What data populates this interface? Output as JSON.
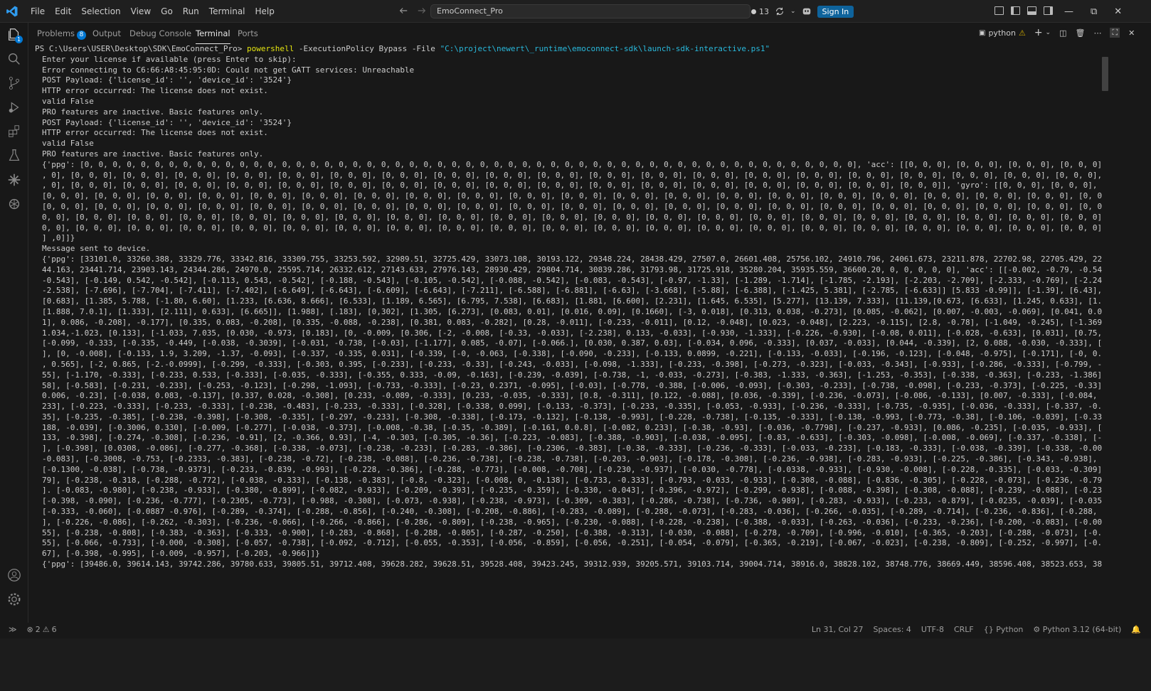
{
  "titlebar": {
    "menu": [
      "File",
      "Edit",
      "Selection",
      "View",
      "Go",
      "Run",
      "Terminal",
      "Help"
    ],
    "search_text": "EmoConnect_Pro",
    "changes_count": "13",
    "signin_label": "Sign In"
  },
  "activity": {
    "explorer_badge": "1"
  },
  "panel": {
    "tabs": [
      "Problems",
      "Output",
      "Debug Console",
      "Terminal",
      "Ports"
    ],
    "problems_count": "8",
    "shell_label": "python"
  },
  "terminal": {
    "lines": [
      {
        "kind": "prompt",
        "prompt": "PS C:\\Users\\USER\\Desktop\\SDK\\EmoConnect_Pro> ",
        "kw": "powershell",
        "args": " -ExecutionPolicy Bypass -File ",
        "path": "\"C:\\project\\newert\\_runtime\\emoconnect-sdk\\launch-sdk-interactive.ps1\""
      },
      {
        "kind": "out",
        "text": "Enter your license if available (press Enter to skip):"
      },
      {
        "kind": "out",
        "text": "Error connecting to C6:66:A8:45:95:0D: Could not get GATT services: Unreachable"
      },
      {
        "kind": "out",
        "text": "POST Payload: {'license_id': '', 'device_id': '3524'}"
      },
      {
        "kind": "out",
        "text": "HTTP error occurred: The license does not exist."
      },
      {
        "kind": "out",
        "text": "valid False"
      },
      {
        "kind": "out",
        "text": "PRO features are inactive. Basic features only."
      },
      {
        "kind": "out",
        "text": "POST Payload: {'license_id': '', 'device_id': '3524'}"
      },
      {
        "kind": "out",
        "text": "HTTP error occurred: The license does not exist."
      },
      {
        "kind": "out",
        "text": "valid False"
      },
      {
        "kind": "out",
        "text": "PRO features are inactive. Basic features only."
      },
      {
        "kind": "out",
        "text": "{'ppg': [0, 0, 0, 0, 0, 0, 0, 0, 0, 0, 0, 0, 0, 0, 0, 0, 0, 0, 0, 0, 0, 0, 0, 0, 0, 0, 0, 0, 0, 0, 0, 0, 0, 0, 0, 0, 0, 0, 0, 0, 0, 0, 0, 0, 0, 0, 0, 0, 0, 0, 0, 0, 0, 0, 0], 'acc': [[0, 0, 0], [0, 0, 0], [0, 0, 0], [0, 0, 0], [0, 0, 0], [0, 0, 0], [0, 0"
      },
      {
        "kind": "out",
        "text": ", 0], [0, 0, 0], [0, 0, 0], [0, 0, 0], [0, 0, 0], [0, 0, 0], [0, 0, 0], [0, 0, 0], [0, 0, 0], [0, 0, 0], [0, 0, 0], [0, 0, 0], [0, 0, 0], [0, 0, 0], [0, 0, 0], [0, 0, 0], [0, 0, 0], [0, 0, 0], [0, 0, 0], [0, 0, 0], [0, 0, 0], [0, 0, 0], [0"
      },
      {
        "kind": "out",
        "text": ", 0], [0, 0, 0], [0, 0, 0], [0, 0, 0], [0, 0, 0], [0, 0, 0], [0, 0, 0], [0, 0, 0], [0, 0, 0], [0, 0, 0], [0, 0, 0], [0, 0, 0], [0, 0, 0], [0, 0, 0], [0, 0, 0], [0, 0, 0], [0, 0, 0], [0, 0, 0]], 'gyro': [[0, 0, 0], [0, 0, 0], [0, 0, 0],[0, 0,"
      },
      {
        "kind": "out",
        "text": "[0, 0, 0], [0, 0, 0], [0, 0, 0], [0, 0, 0], [0, 0, 0], [0, 0, 0], [0, 0, 0], [0, 0, 0], [0, 0, 0], [0, 0, 0], [0, 0, 0], [0, 0, 0], [0, 0, 0], [0, 0, 0], [0, 0, 0], [0, 0, 0], [0, 0, 0], [0, 0, 0], [0, 0, 0], [0, 0, 0], [0, 0,"
      },
      {
        "kind": "out",
        "text": "[0, 0, 0], [0, 0, 0], [0, 0, 0], [0, 0, 0], [0, 0, 0], [0, 0, 0], [0, 0, 0], [0, 0, 0], [0, 0, 0], [0, 0, 0], [0, 0, 0], [0, 0, 0], [0, 0, 0], [0, 0, 0], [0, 0, 0], [0, 0, 0], [0, 0, 0], [0, 0, 0], [0, 0, 0], [0, 0, 0], [0, 0,"
      },
      {
        "kind": "out",
        "text": "0, 0], [0, 0, 0], [0, 0, 0], [0, 0, 0], [0, 0, 0], [0, 0, 0], [0, 0, 0], [0, 0, 0], [0, 0, 0], [0, 0, 0], [0, 0, 0], [0, 0, 0], [0, 0, 0], [0, 0, 0], [0, 0, 0], [0, 0, 0], [0, 0, 0], [0, 0, 0], [0, 0, 0], [0, 0, 0], [0, 0, 0], ["
      },
      {
        "kind": "out",
        "text": "0, 0], [0, 0, 0], [0, 0, 0], [0, 0, 0], [0, 0, 0], [0, 0, 0], [0, 0, 0], [0, 0, 0], [0, 0, 0], [0, 0, 0], [0, 0, 0], [0, 0, 0], [0, 0, 0], [0, 0, 0], [0, 0, 0], [0, 0, 0], [0, 0, 0], [0, 0, 0], [0, 0, 0], [0, 0, 0], [0, 0, 0],[0,0,"
      },
      {
        "kind": "out",
        "text": "] ,0]]}"
      },
      {
        "kind": "out",
        "text": "Message sent to device."
      },
      {
        "kind": "out",
        "text": "{'ppg': [33101.0, 33260.388, 33329.776, 33342.816, 33309.755, 33253.592, 32989.51, 32725.429, 33073.108, 30193.122, 29348.224, 28438.429, 27507.0, 26601.408, 25756.102, 24910.796, 24061.673, 23211.878, 22702.98, 22705.429, 22707.878, 22920.49, 231"
      },
      {
        "kind": "out",
        "text": "44.163, 23441.714, 23903.143, 24344.286, 24970.0, 25595.714, 26332.612, 27143.633, 27976.143, 28930.429, 29804.714, 30839.286, 31793.98, 31725.918, 35280.204, 35935.559, 36600.20, 0, 0, 0, 0, 0], 'acc': [[-0.002, -0.79, -0.547], [-0.001, 0.108,"
      },
      {
        "kind": "out",
        "text": "-0.543], [-0.149, 0.542, -0.542], [-0.113, 0.543, -0.542], [-0.188, -0.543], [-0.105, -0.542], [-0.088, -0.542], [-0.083, -0.543], [-0.97, -1.33], [-1.289, -1.714], [-1.785, -2.193], [-2.203, -2.709], [-2.333, -0.769], [-2.248, -3.593], [-2.706,"
      },
      {
        "kind": "out",
        "text": "-2.538], [-7.696], [-7.704], [-7.411], [-7.402], [-6.649], [-6.643], [-6.609], [-6.643], [-7.211], [-6.588], [-6.881], [-6.63], [-3.668], [-5.88], [-6.388], [-1.425, 5.381], [-2.785, [-6.633]] [5.833 -0.99]], [-1.39], [6.43], [6.27], [-2385, 6.388],"
      },
      {
        "kind": "out",
        "text": "[0.683], [1.385, 5.788, [-1.80, 6.60], [1.233, [6.636, 8.666], [6.533], [1.189, 6.565], [6.795, 7.538], [6.683], [1.881, [6.600], [2.231], [1.645, 6.535], [5.277], [13.139, 7.333], [11.139,[0.673, [6.633], [1.245, 0.633], [1.389], [1.653, 8.39], [6.313"
      },
      {
        "kind": "out",
        "text": "[1.888, 7.0.1], [1.333], [2.111], 0.633], [6.665]], [1.988], [.183], [0,302], [1.305, [6.273], [0.083, 0.01], [0.016, 0.09], [0.1660], [-3, 0.018], [0.313, 0.038, -0.273], [0.085, -0.062], [0.007, -0.003, -0.069], [0.041, 0.016, -0.095], [0.0"
      },
      {
        "kind": "out",
        "text": "1], 0.086, -0.208], -0.177], [0.335, 0.083, -0.208], [0.335, -0.088, -0.238], [0.381, 0.083, -0.282], [0.28, -0.011], [-0.233, -0.011], [0.12, -0.048], [0.023, -0.048], [2.223, -0.115], [2.8, -0.78], [-1.049, -0.245], [-1.369, -0.098, -0.088, [-1"
      },
      {
        "kind": "out",
        "text": "1.034,-1.023, [0.133], [-1.033, 7.035, [0.030, -0.973, [0.183], [0, -0.009, [0.306, [-2, -0.008, [-0.33, -0.033], [-2.238], 0.133, -0.033], [-0.930, -1.333], [-0.226, -0.930], [-0.08, 0.011], [-0.028, -0.633], [0.031], [0.75,-0.099], [-0.246 ["
      },
      {
        "kind": "out",
        "text": "[-0.099, -0.333, [-0.335, -0.449, [-0.038, -0.3039], [-0.031, -0.738, [-0.03], [-1.177], 0.085, -0.07], [-0.066.], [0.030, 0.387, 0.03], [-0.034, 0.096, -0.333], [0.037, -0.033], [0.044, -0.339], [2, 0.088, -0.030, -0.333], [0.028, 0.003, -0.73,"
      },
      {
        "kind": "out",
        "text": "], [0, -0.008], [-0.133, 1.9, 3.209, -1.37, -0.093], [-0.337, -0.335, 0.031], [-0.339, [-0, -0.063, [-0.338], [-0.090, -0.233], [-0.133, 0.0899, -0.221], [-0.133, -0.033], [-0.196, -0.123], [-0.048, -0.975], [-0.171], [-0, 0.080], [-0, -1"
      },
      {
        "kind": "out",
        "text": ", 0.565], [-2, 0.865, [-2.-0.0999], [-0.299, -0.333], [-0.303, 0.395, [-0.233], [-0.233, -0.33], [-0.243, -0.033], [-0.098, -1.333], [-0.233, -0.398], [-0.273, -0.323], [-0.033, -0.343], [-0.933], [-0.286, -0.333], [-0.799, -1.933], [-0.330, 0.3"
      },
      {
        "kind": "out",
        "text": "55], [-1.170, -0.333], [-0.233, 0.533, [-0.333], [-0.035, -0.333], [-0.355, 0.333, -0.09, -0.163], [-0.239, -0.039], [-0.738, -1, -0.033, -0.273], [-0.383, -1.333, -0.363], [-1.253, -0.353], [-0.338, -0.363], [-0.233, -1.386], [-0.239, -0.7"
      },
      {
        "kind": "out",
        "text": "58], [-0.583], [-0.231, -0.233], [-0.253, -0.123], [-0.298, -1.093], [-0.733, -0.333], [-0.23, 0.2371, -0.095], [-0.03], [-0.778, -0.388, [-0.006, -0.093], [-0.303, -0.233], [-0.738, -0.098], [-0.233, -0.373], [-0.225, -0.33], [-0.088,"
      },
      {
        "kind": "out",
        "text": "0.006, -0.23], [-0.038, 0.083, -0.137], [0.337, 0.028, -0.308], [0.233, -0.089, -0.333], [0.233, -0.035, -0.333], [0.8, -0.311], [0.122, -0.088], [0.036, -0.339], [-0.236, -0.073], [-0.086, -0.133], [0.007, -0.333], [-0.084, -0.18], [-0.080, -0."
      },
      {
        "kind": "out",
        "text": "233], [-0.223, -0.333], [-0.233, -0.333], [-0.238, -0.483], [-0.233, -0.333], [-0.328], [-0.338, 0.099], [-0.133, -0.373], [-0.233, -0.335], [-0.053, -0.933], [-0.236, -0.333], [-0.735, -0.935], [-0.036, -0.333], [-0.337, -0.339], [-0.330, -0.33"
      },
      {
        "kind": "out",
        "text": "35], [-0.235, -0.385], [-0.238, -0.398], [-0.308, -0.335], [-0.297, -0.233], [-0.308, -0.338], [-0.173, -0.132], [-0.138, -0.993], [-0.228, -0.738], [-0.135, -0.333], [-0.138, -0.993, [-0.773, -0.38], [-0.106, -0.039], [-0.338, -0.03], [-0"
      },
      {
        "kind": "out",
        "text": "188, -0.039], [-0.3006, 0.330], [-0.009, [-0.277], [-0.038, -0.373], [-0.008, -0.38, [-0.35, -0.389], [-0.161, 0.0.8], [-0.082, 0.233], [-0.38, -0.93], [-0.036, -0.7798], [-0.237, -0.933], [0.086, -0.235], [-0.035, -0.933], [-0.386, -0.06, [-0"
      },
      {
        "kind": "out",
        "text": "133, -0.398], [-0.274, -0.308], [-0.236, -0.91], [2, -0.366, 0.93], [-4, -0.303, [-0.305, -0.36], [-0.223, -0.083], [-0.388, -0.903], [-0.038, -0.095], [-0.83, -0.633], [-0.303, -0.098], [-0.008, -0.069], [-0.337, -0.338], [-0.397], [-0.08"
      },
      {
        "kind": "out",
        "text": "], [-0.398], [0.0308, -0.086], [-0.277, -0.368], [-0.338, -0.073], [-0.238, -0.233], [-0.283, -0.386], [-0.2306, -0.383], [-0.38, -0.333], [-0.236, -0.333], [-0.033, -0.233], [-0.183, -0.333], [-0.038, -0.339], [-0.338, -0.006], [-0.033, [-0.236,"
      },
      {
        "kind": "out",
        "text": "-0.083], [-0.3008, -0.753, [-0.2333, -0.383], [-0.238, -0.72], [-0.238, -0.088], [-0.236, -0.738], [-0.238, -0.738], [-0.203, -0.903], [-0.178, -0.308], [-0.236, -0.938], [-0.283, -0.933], [-0.225, -0.386], [-0.343, -0.938], [-0.238, -0.233],"
      },
      {
        "kind": "out",
        "text": "[-0.1300, -0.038], [-0.738, -0.9373], [-0.233, -0.839, -0.993], [-0.228, -0.386], [-0.288, -0.773], [-0.008, -0.708], [-0.230, -0.937], [-0.030, -0.778], [-0.0338, -0.933], [-0.930, -0.008], [-0.228, -0.335], [-0.033, -0.309], [-0.309, -0.7"
      },
      {
        "kind": "out",
        "text": "79], [-0.238, -0.318, [-0.288, -0.772], [-0.038, -0.333], [-0.138, -0.383], [-0.8, -0.323], [-0.008, 0, -0.138], [-0.733, -0.333], [-0.793, -0.033, -0.933], [-0.308, -0.088], [-0.836, -0.305], [-0.228, -0.073], [-0.236, -0.793], [-0.338, -0.308"
      },
      {
        "kind": "out",
        "text": "]. [-0.083, -0.980], [-0.238, -0.933], [-0.380, -0.899], [-0.082, -0.933], [-0.209, -0.393], [-0.235, -0.359], [-0.330, -0.043], [-0.396, -0.972], [-0.299, -0.938], [-0.088, -0.398], [-0.308, -0.088], [-0.239, -0.088], [-0.238, -0.385],"
      },
      {
        "kind": "out",
        "text": "[-0.398, -0.090], [-0.236, -0.777], [-0.2305, -0.773], [-0.988, -0.308], [-0.073, -0.938], [-0.238, -0.973], [-0.309, -0.383], [-0.286, -0.738], [-0.736, -0.989], [-0.283, -0.933], [-0.233, -0.879], [-0.0235, -0.039], [-0.035, -0.035"
      },
      {
        "kind": "out",
        "text": "[-0.333, -0.060], [-0.0887 -0.976], [-0.289, -0.374], [-0.288, -0.856], [-0.240, -0.308], [-0.208, -0.886], [-0.283, -0.089], [-0.288, -0.073], [-0.283, -0.036], [-0.266, -0.035], [-0.289, -0.714], [-0.236, -0.836], [-0.288, -0.736"
      },
      {
        "kind": "out",
        "text": "], [-0.226, -0.086], [-0.262, -0.303], [-0.236, -0.066], [-0.266, -0.866], [-0.286, -0.809], [-0.238, -0.965], [-0.230, -0.088], [-0.228, -0.238], [-0.388, -0.033], [-0.263, -0.036], [-0.233, -0.236], [-0.200, -0.083], [-0.008, -0.05"
      },
      {
        "kind": "out",
        "text": "55], [-0.238, -0.808], [-0.383, -0.363], [-0.333, -0.900], [-0.283, -0.868], [-0.288, -0.805], [-0.287, -0.250], [-0.388, -0.313], [-0.030, -0.088], [-0.278, -0.709], [-0.996, -0.010], [-0.365, -0.203], [-0.288, -0.073], [-0.366, -0.1"
      },
      {
        "kind": "out",
        "text": "55], [-0.066, -0.733], [-0.000, -0.308], [-0.057, -0.738], [-0.092, -0.712], [-0.055, -0.353], [-0.056, -0.859], [-0.056, -0.251], [-0.054, -0.079], [-0.365, -0.219], [-0.067, -0.023], [-0.238, -0.809], [-0.252, -0.997], [-0.278, -0.0"
      },
      {
        "kind": "out",
        "text": "67], [-0.398, -0.995], [-0.009, -0.957], [-0.203, -0.966]]}"
      },
      {
        "kind": "out",
        "text": "{'ppg': [39486.0, 39614.143, 39742.286, 39780.633, 39805.51, 39712.408, 39628.282, 39628.51, 39528.408, 39423.245, 39312.939, 39205.571, 39103.714, 39004.714, 38916.0, 38828.102, 38748.776, 38669.449, 38596.408, 38523.653, 38452.857, 38389.286,"
      }
    ]
  },
  "statusbar": {
    "errors": "2",
    "warnings": "6",
    "position": "Ln 31, Col 27",
    "spaces": "Spaces: 4",
    "encoding": "UTF-8",
    "eol": "CRLF",
    "language": "Python",
    "interpreter": "Python 3.12 (64-bit)"
  },
  "colors": {
    "accent": "#0078d4",
    "signin": "#0e639c",
    "terminal_bg": "#181818",
    "command_yellow": "#e5e510",
    "path_cyan": "#29b8db"
  }
}
